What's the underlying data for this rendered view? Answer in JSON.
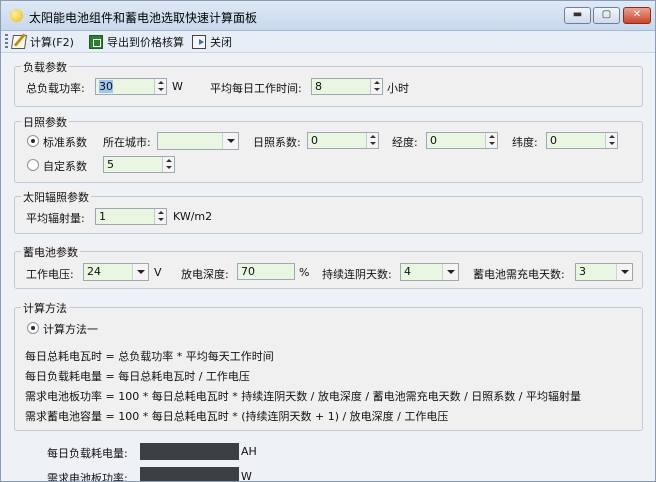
{
  "window": {
    "title": "太阳能电池组件和蓄电池选取快速计算面板",
    "min_glyph": "▬",
    "max_glyph": "▢",
    "close_glyph": "✕"
  },
  "toolbar": {
    "calc_label": "计算(F2)",
    "export_label": "导出到价格核算",
    "close_label": "关闭"
  },
  "load": {
    "legend": "负载参数",
    "total_power_label": "总负载功率:",
    "total_power_value": "30",
    "total_power_unit": "W",
    "hours_label": "平均每日工作时间:",
    "hours_value": "8",
    "hours_unit": "小时"
  },
  "sunlight": {
    "legend": "日照参数",
    "standard_label": "标准系数",
    "city_label": "所在城市:",
    "city_value": "",
    "sun_coef_label": "日照系数:",
    "sun_coef_value": "0",
    "longitude_label": "经度:",
    "longitude_value": "0",
    "latitude_label": "纬度:",
    "latitude_value": "0",
    "custom_label": "自定系数",
    "custom_value": "5"
  },
  "radiation": {
    "legend": "太阳辐照参数",
    "label": "平均辐射量:",
    "value": "1",
    "unit": "KW/m2"
  },
  "battery": {
    "legend": "蓄电池参数",
    "voltage_label": "工作电压:",
    "voltage_value": "24",
    "voltage_unit": "V",
    "depth_label": "放电深度:",
    "depth_value": "70",
    "depth_unit": "%",
    "cloudy_label": "持续连阴天数:",
    "cloudy_value": "4",
    "charge_label": "蓄电池需充电天数:",
    "charge_value": "3"
  },
  "method": {
    "legend": "计算方法",
    "option_label": "计算方法一",
    "formulas": [
      "每日总耗电瓦时 = 总负载功率 * 平均每天工作时间",
      "每日负载耗电量 = 每日总耗电瓦时 / 工作电压",
      "需求电池板功率 = 100 * 每日总耗电瓦时 * 持续连阴天数 / 放电深度 / 蓄电池需充电天数 / 日照系数 / 平均辐射量",
      "需求蓄电池容量 = 100 * 每日总耗电瓦时 * (持续连阴天数 + 1) / 放电深度 / 工作电压"
    ]
  },
  "results": {
    "daily_load_label": "每日负载耗电量:",
    "daily_load_unit": "AH",
    "panel_power_label": "需求电池板功率:",
    "panel_power_unit": "W"
  }
}
